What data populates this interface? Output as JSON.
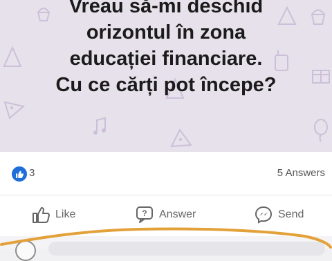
{
  "question": {
    "lines": [
      "Vreau să-mi deschid",
      "orizontul în zona",
      "educației financiare.",
      "Cu ce cărți pot începe?"
    ]
  },
  "stats": {
    "likes": "3",
    "answers": "5 Answers"
  },
  "actions": {
    "like_label": "Like",
    "answer_label": "Answer",
    "send_label": "Send"
  },
  "icons": {
    "like": "thumbs-up-icon",
    "answer": "question-bubble-icon",
    "send": "messenger-icon"
  },
  "colors": {
    "brand_blue": "#1e6fd9",
    "highlight": "#e3a13a",
    "pattern": "#cdbfd9"
  }
}
